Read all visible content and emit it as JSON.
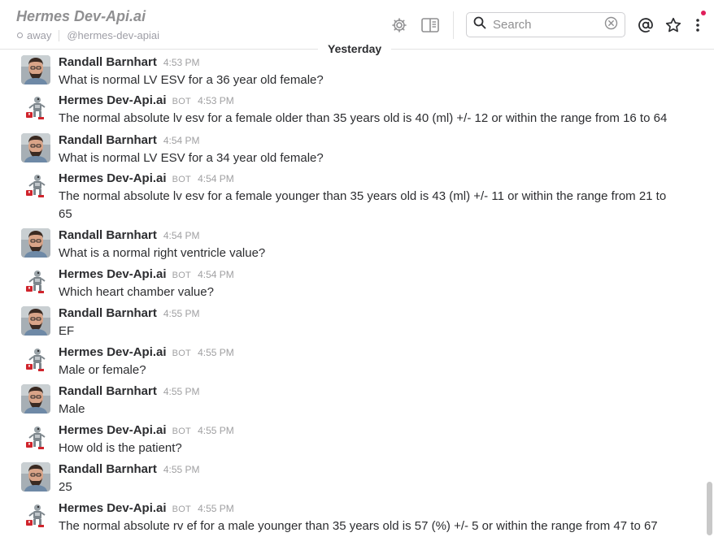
{
  "header": {
    "channel_name": "Hermes Dev-Api.ai",
    "presence": "away",
    "handle": "@hermes-dev-apiai",
    "icons": [
      "gear-icon",
      "sidebar-toggle-icon",
      "at-mention-icon",
      "star-icon",
      "more-vertical-icon"
    ],
    "search": {
      "placeholder": "Search",
      "value": ""
    },
    "notification_color": "#e01e5a"
  },
  "day_divider": "Yesterday",
  "messages": [
    {
      "sender": "Randall Barnhart",
      "bot": false,
      "time": "4:53 PM",
      "text": "What is normal LV ESV for a 36 year old female?"
    },
    {
      "sender": "Hermes Dev-Api.ai",
      "bot": true,
      "bot_tag": "BOT",
      "time": "4:53 PM",
      "text": "The normal absolute lv esv for a female older than 35 years old is 40 (ml) +/- 12 or within the range from 16 to 64"
    },
    {
      "sender": "Randall Barnhart",
      "bot": false,
      "time": "4:54 PM",
      "text": "What is normal LV ESV for a 34 year old female?"
    },
    {
      "sender": "Hermes Dev-Api.ai",
      "bot": true,
      "bot_tag": "BOT",
      "time": "4:54 PM",
      "text": "The normal absolute lv esv for a female younger than 35 years old is 43 (ml) +/- 11 or within the range from 21 to 65"
    },
    {
      "sender": "Randall Barnhart",
      "bot": false,
      "time": "4:54 PM",
      "text": "What is a normal right ventricle value?"
    },
    {
      "sender": "Hermes Dev-Api.ai",
      "bot": true,
      "bot_tag": "BOT",
      "time": "4:54 PM",
      "text": "Which heart chamber value?"
    },
    {
      "sender": "Randall Barnhart",
      "bot": false,
      "time": "4:55 PM",
      "text": "EF"
    },
    {
      "sender": "Hermes Dev-Api.ai",
      "bot": true,
      "bot_tag": "BOT",
      "time": "4:55 PM",
      "text": "Male or female?"
    },
    {
      "sender": "Randall Barnhart",
      "bot": false,
      "time": "4:55 PM",
      "text": "Male"
    },
    {
      "sender": "Hermes Dev-Api.ai",
      "bot": true,
      "bot_tag": "BOT",
      "time": "4:55 PM",
      "text": "How old is the patient?"
    },
    {
      "sender": "Randall Barnhart",
      "bot": false,
      "time": "4:55 PM",
      "text": "25"
    },
    {
      "sender": "Hermes Dev-Api.ai",
      "bot": true,
      "bot_tag": "BOT",
      "time": "4:55 PM",
      "text": "The normal absolute rv ef for a male younger than 35 years old is 57 (%) +/- 5 or within the range from 47 to 67"
    }
  ]
}
